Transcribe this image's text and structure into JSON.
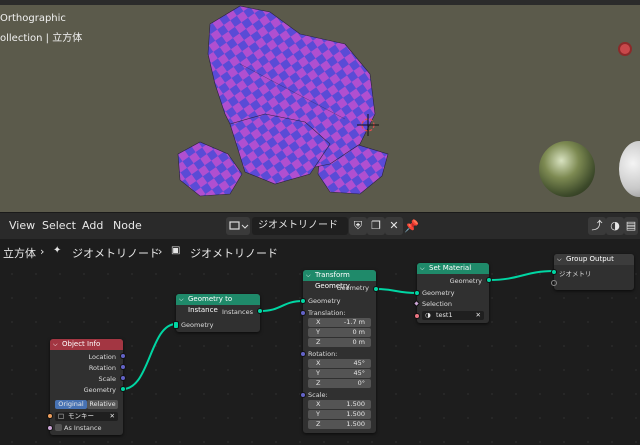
{
  "viewport": {
    "view_label": "Orthographic",
    "collection_label": "ollection | 立方体",
    "colors": {
      "background": "#5b5a4b",
      "suzanne_a": "#b04fd0",
      "suzanne_b": "#5a4bd6"
    }
  },
  "header": {
    "menus": [
      "View",
      "Select",
      "Add",
      "Node"
    ],
    "node_tree_name": "ジオメトリノード",
    "pin_icon": "pin-icon"
  },
  "breadcrumb": {
    "items": [
      "立方体",
      "ジオメトリノード",
      "ジオメトリノード"
    ]
  },
  "nodes": {
    "object_info": {
      "title": "Object Info",
      "color": "#a33642",
      "outputs": [
        "Location",
        "Rotation",
        "Scale",
        "Geometry"
      ],
      "mode_buttons": [
        "Original",
        "Relative"
      ],
      "object_value": "モンキー",
      "as_instance_label": "As Instance"
    },
    "geometry_to_instance": {
      "title": "Geometry to Instance",
      "color": "#1f8a6a",
      "output": "Instances",
      "input": "Geometry"
    },
    "transform_geometry": {
      "title": "Transform Geometry",
      "color": "#1f8a6a",
      "output": "Geometry",
      "input": "Geometry",
      "translation_label": "Translation:",
      "translation": [
        {
          "k": "X",
          "v": "-1.7 m"
        },
        {
          "k": "Y",
          "v": "0 m"
        },
        {
          "k": "Z",
          "v": "0 m"
        }
      ],
      "rotation_label": "Rotation:",
      "rotation": [
        {
          "k": "X",
          "v": "45°"
        },
        {
          "k": "Y",
          "v": "45°"
        },
        {
          "k": "Z",
          "v": "0°"
        }
      ],
      "scale_label": "Scale:",
      "scale": [
        {
          "k": "X",
          "v": "1.500"
        },
        {
          "k": "Y",
          "v": "1.500"
        },
        {
          "k": "Z",
          "v": "1.500"
        }
      ]
    },
    "set_material": {
      "title": "Set Material",
      "color": "#1f8a6a",
      "output": "Geometry",
      "inputs": [
        "Geometry",
        "Selection"
      ],
      "material_value": "test1"
    },
    "group_output": {
      "title": "Group Output",
      "color": "#3c3c3c",
      "input": "ジオメトリ"
    }
  }
}
